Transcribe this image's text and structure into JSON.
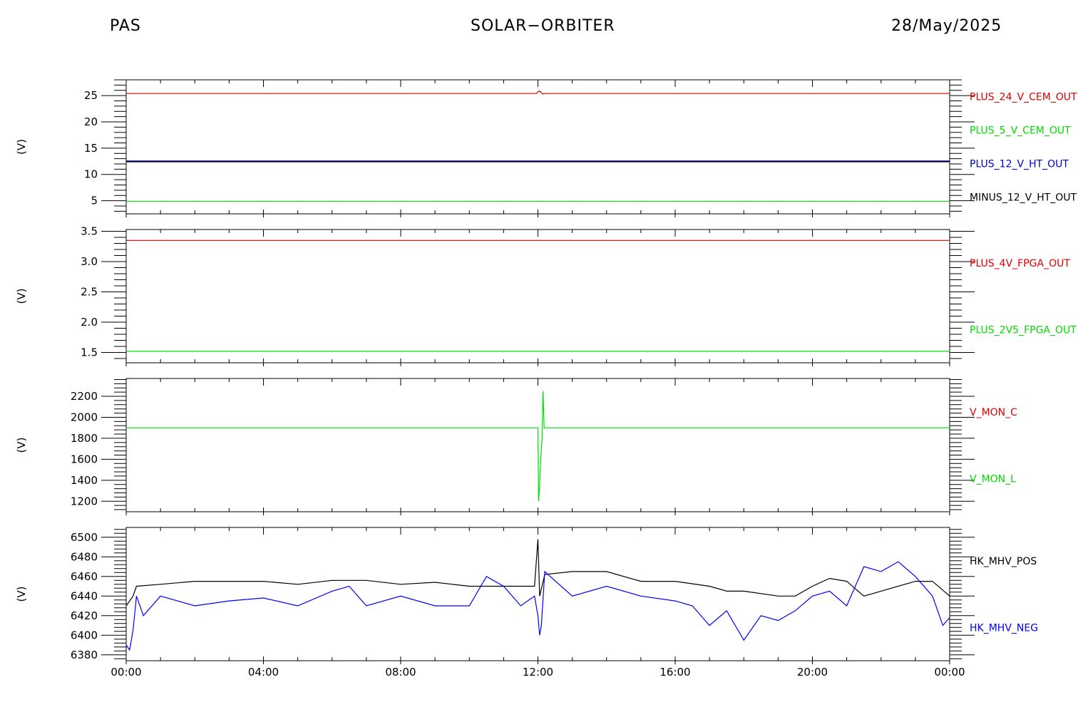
{
  "header": {
    "left": "PAS",
    "center": "SOLAR−ORBITER",
    "right": "28/May/2025"
  },
  "x_axis": {
    "range_hours": [
      0,
      24
    ],
    "tick_hours": [
      0,
      4,
      8,
      12,
      16,
      20,
      24
    ],
    "tick_labels": [
      "00:00",
      "04:00",
      "08:00",
      "12:00",
      "16:00",
      "20:00",
      "00:00"
    ]
  },
  "chart_data": [
    {
      "type": "line",
      "ylabel": "(V)",
      "ylim": [
        2.5,
        28
      ],
      "yticks": [
        5,
        10,
        15,
        20,
        25
      ],
      "yticklabels": [
        "5",
        "10",
        "15",
        "20",
        "25"
      ],
      "legend_placement": "right",
      "series": [
        {
          "name": "PLUS_24_V_CEM_OUT",
          "color": "#dd0000",
          "x": [
            0,
            11.95,
            12.0,
            12.05,
            12.1,
            12.15,
            12.2,
            24
          ],
          "y": [
            25.4,
            25.4,
            25.7,
            25.9,
            25.5,
            25.3,
            25.4,
            25.4
          ]
        },
        {
          "name": "PLUS_5_V_CEM_OUT",
          "color": "#00dd00",
          "x": [
            0,
            24
          ],
          "y": [
            4.9,
            4.9
          ]
        },
        {
          "name": "PLUS_12_V_HT_OUT",
          "color": "#0000cc",
          "x": [
            0,
            24
          ],
          "y": [
            12.5,
            12.5
          ]
        },
        {
          "name": "MINUS_12_V_HT_OUT",
          "color": "#000000",
          "x": [
            0,
            24
          ],
          "y": [
            12.4,
            12.4
          ]
        }
      ]
    },
    {
      "type": "line",
      "ylabel": "(V)",
      "ylim": [
        1.33,
        3.53
      ],
      "yticks": [
        1.5,
        2.0,
        2.5,
        3.0,
        3.5
      ],
      "yticklabels": [
        "1.5",
        "2.0",
        "2.5",
        "3.0",
        "3.5"
      ],
      "legend_placement": "right",
      "series": [
        {
          "name": "PLUS_4V_FPGA_OUT",
          "color": "#dd0000",
          "x": [
            0,
            24
          ],
          "y": [
            3.35,
            3.35
          ]
        },
        {
          "name": "PLUS_2V5_FPGA_OUT",
          "color": "#00dd00",
          "x": [
            0,
            24
          ],
          "y": [
            1.52,
            1.52
          ]
        }
      ]
    },
    {
      "type": "line",
      "ylabel": "(V)",
      "ylim": [
        1100,
        2370
      ],
      "yticks": [
        1200,
        1400,
        1600,
        1800,
        2000,
        2200
      ],
      "yticklabels": [
        "1200",
        "1400",
        "1600",
        "1800",
        "2000",
        "2200"
      ],
      "legend_placement": "right",
      "series": [
        {
          "name": "V_MON_C",
          "color": "#dd0000",
          "x": [],
          "y": []
        },
        {
          "name": "V_MON_L",
          "color": "#00dd00",
          "x": [
            0,
            12.0,
            12.02,
            12.05,
            12.08,
            12.12,
            12.15,
            12.18,
            12.22,
            24
          ],
          "y": [
            1900,
            1900,
            1200,
            1350,
            1600,
            1800,
            2250,
            1900,
            1900,
            1900
          ]
        }
      ]
    },
    {
      "type": "line",
      "ylabel": "(V)",
      "ylim": [
        6374,
        6510
      ],
      "yticks": [
        6380,
        6400,
        6420,
        6440,
        6460,
        6480,
        6500
      ],
      "yticklabels": [
        "6380",
        "6400",
        "6420",
        "6440",
        "6460",
        "6480",
        "6500"
      ],
      "legend_placement": "right",
      "series": [
        {
          "name": "HK_MHV_POS",
          "color": "#000000",
          "x": [
            0,
            0.2,
            0.3,
            1.0,
            2.0,
            3.0,
            4.0,
            5.0,
            6.0,
            7.0,
            8.0,
            9.0,
            10.0,
            11.0,
            11.9,
            12.0,
            12.05,
            12.2,
            13.0,
            14.0,
            15.0,
            16.0,
            17.0,
            17.5,
            18.0,
            19.0,
            19.5,
            20.0,
            20.5,
            21.0,
            21.5,
            22.0,
            23.0,
            23.5,
            24
          ],
          "y": [
            6430,
            6440,
            6450,
            6452,
            6455,
            6455,
            6455,
            6452,
            6456,
            6456,
            6452,
            6454,
            6450,
            6450,
            6450,
            6498,
            6440,
            6462,
            6465,
            6465,
            6455,
            6455,
            6450,
            6445,
            6445,
            6440,
            6440,
            6450,
            6458,
            6455,
            6440,
            6445,
            6455,
            6455,
            6440
          ]
        },
        {
          "name": "HK_MHV_NEG",
          "color": "#0000ff",
          "x": [
            0,
            0.1,
            0.2,
            0.3,
            0.5,
            1.0,
            2.0,
            3.0,
            4.0,
            5.0,
            6.0,
            6.5,
            7.0,
            8.0,
            9.0,
            10.0,
            10.5,
            11.0,
            11.5,
            11.9,
            12.0,
            12.05,
            12.1,
            12.2,
            13.0,
            14.0,
            15.0,
            16.0,
            16.5,
            17.0,
            17.5,
            18.0,
            18.5,
            19.0,
            19.5,
            20.0,
            20.5,
            21.0,
            21.5,
            22.0,
            22.5,
            23.0,
            23.5,
            23.8,
            24
          ],
          "y": [
            6390,
            6385,
            6405,
            6440,
            6420,
            6440,
            6430,
            6435,
            6438,
            6430,
            6445,
            6450,
            6430,
            6440,
            6430,
            6430,
            6460,
            6450,
            6430,
            6440,
            6420,
            6400,
            6410,
            6465,
            6440,
            6450,
            6440,
            6435,
            6430,
            6410,
            6425,
            6395,
            6420,
            6415,
            6425,
            6440,
            6445,
            6430,
            6470,
            6465,
            6475,
            6460,
            6440,
            6410,
            6418
          ]
        }
      ]
    }
  ]
}
